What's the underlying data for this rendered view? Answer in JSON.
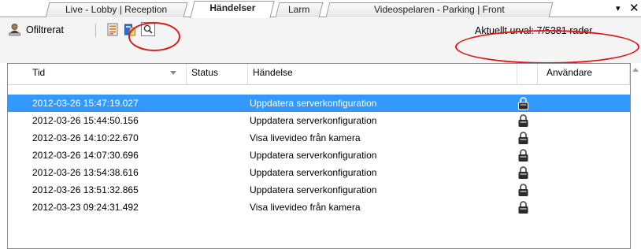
{
  "tabs": [
    {
      "label": "Live - Lobby | Reception",
      "active": false
    },
    {
      "label": "Händelser",
      "active": true
    },
    {
      "label": "Larm",
      "active": false
    },
    {
      "label": "Videospelaren - Parking | Front",
      "active": false
    }
  ],
  "window_controls": {
    "menu": "▾",
    "close": "✕"
  },
  "toolbar": {
    "filter_label": "Ofiltrerat",
    "status": "Aktuellt urval: 7/5381 rader"
  },
  "columns": {
    "tid": "Tid",
    "status": "Status",
    "handelse": "Händelse",
    "anvandare": "Användare"
  },
  "rows": [
    {
      "tid": "2012-03-26 15:47:19.027",
      "status": "",
      "handelse": "Uppdatera serverkonfiguration",
      "anvandare": "",
      "selected": true
    },
    {
      "tid": "2012-03-26 15:44:50.156",
      "status": "",
      "handelse": "Uppdatera serverkonfiguration",
      "anvandare": ""
    },
    {
      "tid": "2012-03-26 14:10:22.670",
      "status": "",
      "handelse": "Visa livevideo från kamera",
      "anvandare": ""
    },
    {
      "tid": "2012-03-26 14:07:30.696",
      "status": "",
      "handelse": "Uppdatera serverkonfiguration",
      "anvandare": ""
    },
    {
      "tid": "2012-03-26 13:54:38.616",
      "status": "",
      "handelse": "Uppdatera serverkonfiguration",
      "anvandare": ""
    },
    {
      "tid": "2012-03-26 13:51:32.865",
      "status": "",
      "handelse": "Uppdatera serverkonfiguration",
      "anvandare": ""
    },
    {
      "tid": "2012-03-23 09:24:31.492",
      "status": "",
      "handelse": "Visa livevideo från kamera",
      "anvandare": ""
    }
  ],
  "colors": {
    "selection": "#3399ff",
    "annotation_circle": "#e01a1a"
  },
  "icons": {
    "filter": "user-filter-icon",
    "export": "export-icon",
    "report": "report-icon",
    "search": "search-icon",
    "lock": "lock-icon"
  }
}
